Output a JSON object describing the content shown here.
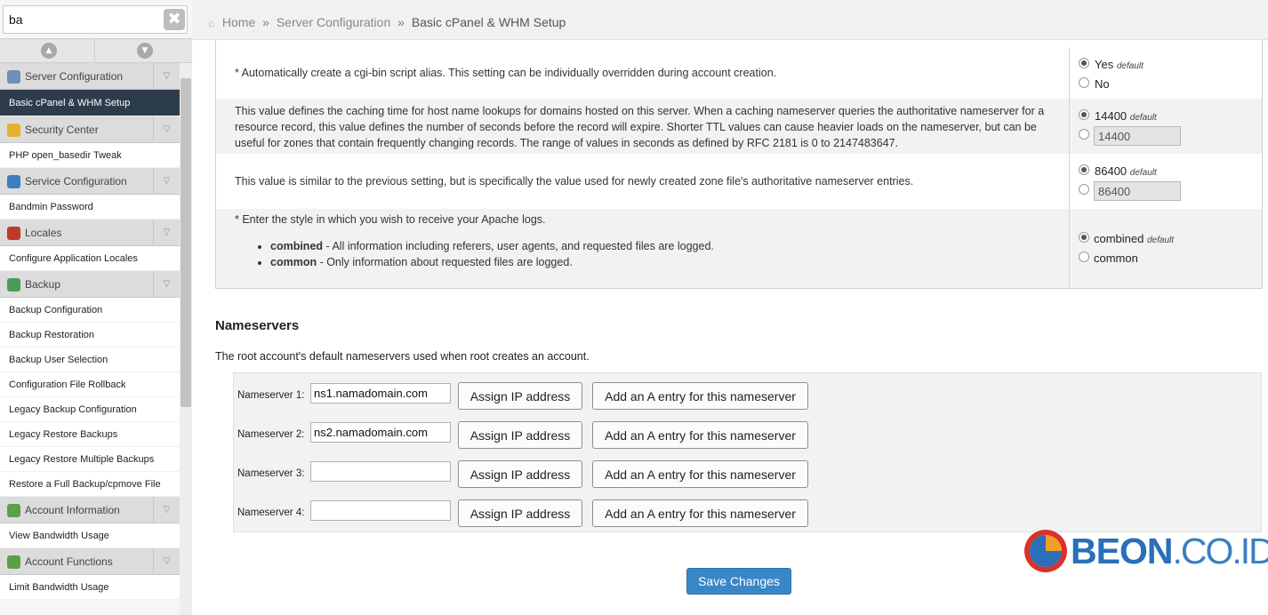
{
  "search": {
    "value": "ba",
    "clear_glyph": "✖"
  },
  "collapse": {
    "up_glyph": "▲",
    "down_glyph": "▼"
  },
  "sidebar": {
    "chevron_glyph": "▽",
    "sections": [
      {
        "label": "Server Configuration",
        "icon": "server-config-icon",
        "color": "#6d8fb8",
        "items": [
          {
            "label": "Basic cPanel & WHM Setup",
            "active": true
          }
        ]
      },
      {
        "label": "Security Center",
        "icon": "lock-icon",
        "color": "#e3b030",
        "items": [
          {
            "label": "PHP open_basedir Tweak"
          }
        ]
      },
      {
        "label": "Service Configuration",
        "icon": "gear-icon",
        "color": "#3f7fc1",
        "items": [
          {
            "label": "Bandmin Password"
          }
        ]
      },
      {
        "label": "Locales",
        "icon": "flag-icon",
        "color": "#c0392b",
        "items": [
          {
            "label": "Configure Application Locales"
          }
        ]
      },
      {
        "label": "Backup",
        "icon": "backup-icon",
        "color": "#4c9a5a",
        "items": [
          {
            "label": "Backup Configuration"
          },
          {
            "label": "Backup Restoration"
          },
          {
            "label": "Backup User Selection"
          },
          {
            "label": "Configuration File Rollback"
          },
          {
            "label": "Legacy Backup Configuration"
          },
          {
            "label": "Legacy Restore Backups"
          },
          {
            "label": "Legacy Restore Multiple Backups"
          },
          {
            "label": "Restore a Full Backup/cpmove File"
          }
        ]
      },
      {
        "label": "Account Information",
        "icon": "account-info-icon",
        "color": "#5aa04a",
        "items": [
          {
            "label": "View Bandwidth Usage"
          }
        ]
      },
      {
        "label": "Account Functions",
        "icon": "account-functions-icon",
        "color": "#5aa04a",
        "items": [
          {
            "label": "Limit Bandwidth Usage"
          }
        ]
      }
    ]
  },
  "breadcrumb": {
    "home": "Home",
    "sep": "»",
    "section": "Server Configuration",
    "current": "Basic cPanel & WHM Setup"
  },
  "settings": {
    "cgi": {
      "description": "* Automatically create a cgi-bin script alias. This setting can be individually overridden during account creation.",
      "opt_yes": "Yes",
      "opt_no": "No",
      "default_tag": "default"
    },
    "ttl": {
      "description": "This value defines the caching time for host name lookups for domains hosted on this server. When a caching nameserver queries the authoritative nameserver for a resource record, this value defines the number of seconds before the record will expire. Shorter TTL values can cause heavier loads on the nameserver, but can be useful for zones that contain frequently changing records. The range of values in seconds as defined by RFC 2181 is 0 to 2147483647.",
      "default_value": "14400",
      "default_tag": "default",
      "input_value": "14400"
    },
    "ns_ttl": {
      "description": "This value is similar to the previous setting, but is specifically the value used for newly created zone file's authoritative nameserver entries.",
      "default_value": "86400",
      "default_tag": "default",
      "input_value": "86400"
    },
    "apache_logs": {
      "description": "* Enter the style in which you wish to receive your Apache logs.",
      "bullet1_term": "combined",
      "bullet1_text": " - All information including referers, user agents, and requested files are logged.",
      "bullet2_term": "common",
      "bullet2_text": " - Only information about requested files are logged.",
      "opt_combined": "combined",
      "opt_common": "common",
      "default_tag": "default"
    }
  },
  "nameservers": {
    "title": "Nameservers",
    "description": "The root account's default nameservers used when root creates an account.",
    "assign_label": "Assign IP address",
    "aentry_label": "Add an A entry for this nameserver",
    "rows": [
      {
        "label": "Nameserver 1:",
        "value": "ns1.namadomain.com"
      },
      {
        "label": "Nameserver 2:",
        "value": "ns2.namadomain.com"
      },
      {
        "label": "Nameserver 3:",
        "value": ""
      },
      {
        "label": "Nameserver 4:",
        "value": ""
      }
    ]
  },
  "save_label": "Save Changes",
  "watermark": {
    "brand": "BEON",
    "domain": ".CO.ID",
    "colors": {
      "blue": "#2a6fb7",
      "red": "#d8322a",
      "orange": "#f0a028"
    }
  }
}
